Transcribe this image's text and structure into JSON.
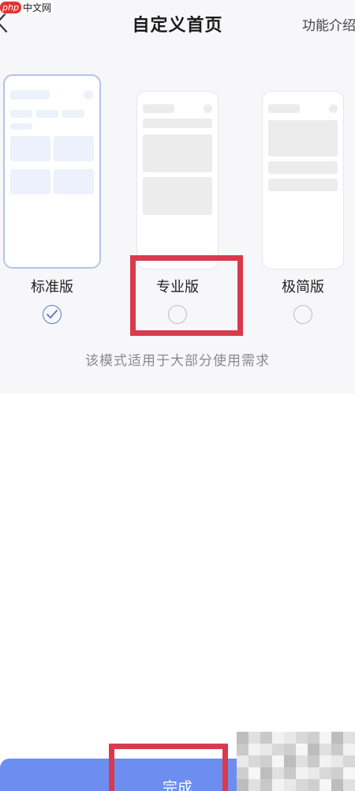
{
  "watermark": {
    "badge": "php",
    "text": "中文网"
  },
  "header": {
    "title": "自定义首页",
    "features_link": "功能介绍"
  },
  "options": [
    {
      "label": "标准版",
      "selected": true
    },
    {
      "label": "专业版",
      "selected": false
    },
    {
      "label": "极简版",
      "selected": false
    }
  ],
  "description": "该模式适用于大部分使用需求",
  "footer": {
    "done_label": "完成"
  },
  "colors": {
    "accent": "#6b8ef0",
    "highlight": "#d93a4d",
    "selected_outline": "#b5c4e8",
    "check": "#5a78c7"
  }
}
